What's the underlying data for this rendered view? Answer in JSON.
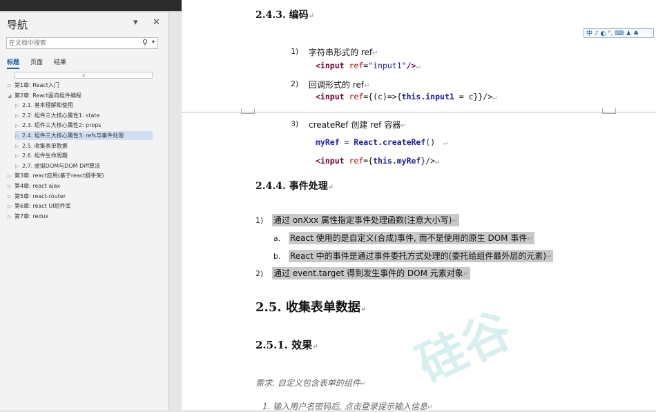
{
  "nav": {
    "title": "导航",
    "search_placeholder": "在文档中搜索",
    "tabs": [
      "标题",
      "页面",
      "结果"
    ],
    "collapse": "⌅",
    "items": [
      {
        "label": "第1章: React入门"
      },
      {
        "label": "第2章: React面向组件编程"
      },
      {
        "label": "2.1. 基本理解和使用"
      },
      {
        "label": "2.2. 组件三大核心属性1: state"
      },
      {
        "label": "2.3. 组件三大核心属性2: props"
      },
      {
        "label": "2.4. 组件三大核心属性3: refs与事件处理"
      },
      {
        "label": "2.5. 收集表单数据"
      },
      {
        "label": "2.6. 组件生命周期"
      },
      {
        "label": "2.7. 虚拟DOM与DOM Diff算法"
      },
      {
        "label": "第3章: react应用(基于react脚手架)"
      },
      {
        "label": "第4章: react ajax"
      },
      {
        "label": "第5章: react-router"
      },
      {
        "label": "第6章: react UI组件库"
      },
      {
        "label": "第7章: redux"
      }
    ]
  },
  "ime": "中 ♪ ◐ °, ⌨ ♟ ♣",
  "doc": {
    "h_243": "2.4.3. 编码",
    "l1_num": "1)",
    "l1_text": "字符串形式的 ref",
    "l1_code_a": "<input ",
    "l1_code_b": "ref",
    "l1_code_c": "=",
    "l1_code_d": "\"input1\"",
    "l1_code_e": "/>",
    "l2_num": "2)",
    "l2_text": "回调形式的 ref",
    "l2_code_a": "<input ",
    "l2_code_b": "ref",
    "l2_code_c": "={(c)=>{",
    "l2_code_d": "this.input1",
    "l2_code_e": " = c}}/>",
    "l3_num": "3)",
    "l3_text": "createRef 创建 ref 容器",
    "l3_code1_a": "myRef",
    "l3_code1_b": " = ",
    "l3_code1_c": "React.createRef",
    "l3_code1_d": "()",
    "l3_code2_a": "<input ",
    "l3_code2_b": "ref",
    "l3_code2_c": "={",
    "l3_code2_d": "this.myRef",
    "l3_code2_e": "}/>",
    "h_244": "2.4.4. 事件处理",
    "e1_num": "1)",
    "e1_text": "通过 onXxx 属性指定事件处理函数(注意大小写)",
    "ea_num": "a.",
    "ea_text": "React 使用的是自定义(合成)事件, 而不是使用的原生 DOM 事件",
    "eb_num": "b.",
    "eb_text": "React 中的事件是通过事件委托方式处理的(委托给组件最外层的元素)",
    "e2_num": "2)",
    "e2_text": "通过 event.target 得到发生事件的 DOM 元素对象",
    "h_25": "2.5. 收集表单数据",
    "h_251": "2.5.1. 效果",
    "req": "需求: 自定义包含表单的组件",
    "req1": "1. 输入用户名密码后, 点击登录提示输入信息",
    "para_mark": "↵",
    "watermark": "硅谷"
  }
}
